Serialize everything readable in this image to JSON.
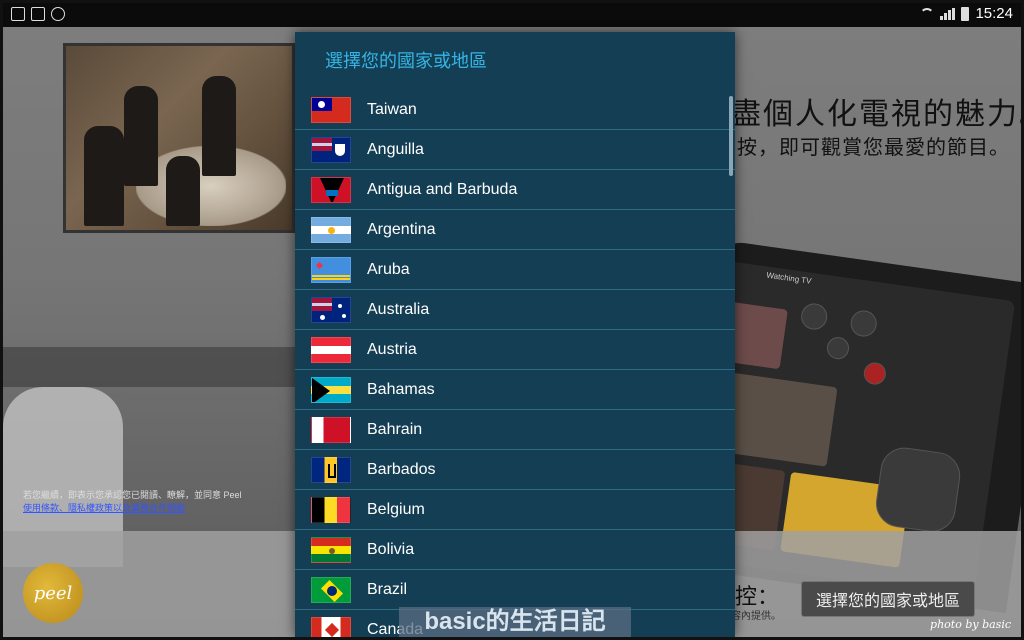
{
  "status_bar": {
    "time": "15:24"
  },
  "background": {
    "headline": "盡個人化電視的魅力。",
    "subline": "按，即可觀賞您最愛的節目。",
    "tablet_label": "Watching TV",
    "legal_text": "若您繼續，即表示您承認您已閱讀、瞭解，並同意 Peel",
    "legal_link": "使用條款、隱私權政策以及業務合作規範"
  },
  "bottom_bar": {
    "logo_text": "peel",
    "control_label": "控：",
    "provider_text": "容內提供。",
    "country_button": "選擇您的國家或地區"
  },
  "dialog": {
    "title": "選擇您的國家或地區",
    "countries": [
      {
        "name": "Taiwan",
        "flag": "taiwan-flag"
      },
      {
        "name": "Anguilla",
        "flag": "anguilla-flag"
      },
      {
        "name": "Antigua and Barbuda",
        "flag": "antigua-flag"
      },
      {
        "name": "Argentina",
        "flag": "argentina-flag"
      },
      {
        "name": "Aruba",
        "flag": "aruba-flag"
      },
      {
        "name": "Australia",
        "flag": "australia-flag"
      },
      {
        "name": "Austria",
        "flag": "austria-flag"
      },
      {
        "name": "Bahamas",
        "flag": "bahamas-flag"
      },
      {
        "name": "Bahrain",
        "flag": "bahrain-flag"
      },
      {
        "name": "Barbados",
        "flag": "barbados-flag"
      },
      {
        "name": "Belgium",
        "flag": "belgium-flag"
      },
      {
        "name": "Bolivia",
        "flag": "bolivia-flag"
      },
      {
        "name": "Brazil",
        "flag": "brazil-flag"
      },
      {
        "name": "Canada",
        "flag": "canada-flag"
      }
    ]
  },
  "watermark": "basic的生活日記",
  "photo_credit": "photo by basic",
  "colors": {
    "dialog_bg": "#143e54",
    "dialog_title": "#35b5e5",
    "divider": "#2f6b82"
  }
}
